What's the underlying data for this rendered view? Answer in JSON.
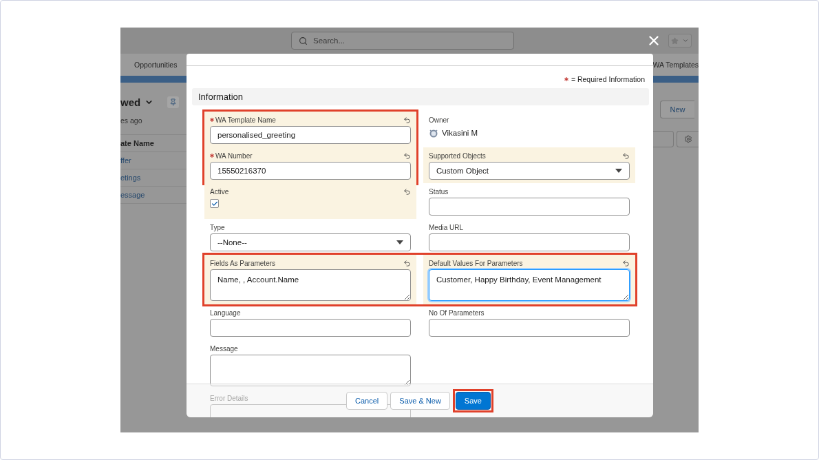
{
  "app": {
    "search": {
      "placeholder": "Search..."
    },
    "nav": [
      {
        "label": "Opportunities"
      },
      {
        "label": "WA Templates"
      }
    ],
    "list_view": {
      "title": "wed",
      "updated": "es ago",
      "column": "ate Name",
      "rows": [
        "ffer",
        "etings",
        "essage"
      ]
    },
    "new_button": "New"
  },
  "modal": {
    "required_note": "= Required Information",
    "section": "Information",
    "blocks": [
      {
        "kind": "columns",
        "columns": [
          [
            {
              "kind": "text",
              "label": "WA Template Name",
              "required": true,
              "changed": true,
              "annotated": true,
              "focused": false,
              "value": "personalised_greeting"
            },
            {
              "kind": "text",
              "label": "WA Number",
              "required": true,
              "changed": true,
              "annotated": true,
              "focused": false,
              "value": "15550216370"
            },
            {
              "kind": "checkbox",
              "label": "Active",
              "required": false,
              "changed": true,
              "annotated": false,
              "checked": true
            }
          ],
          [
            {
              "kind": "owner",
              "label": "Owner",
              "required": false,
              "changed": false,
              "annotated": false,
              "value": "Vikasini M"
            },
            {
              "kind": "select",
              "label": "Supported Objects",
              "required": false,
              "changed": true,
              "annotated": false,
              "value": "Custom Object"
            },
            {
              "kind": "text",
              "label": "Status",
              "required": false,
              "changed": false,
              "annotated": false,
              "focused": false
            }
          ]
        ]
      },
      {
        "kind": "row",
        "annotated": false,
        "cells": [
          {
            "kind": "select",
            "label": "Type",
            "required": false,
            "changed": false,
            "value": "--None--"
          },
          {
            "kind": "text",
            "label": "Media URL",
            "required": false,
            "changed": false,
            "focused": false
          }
        ]
      },
      {
        "kind": "row",
        "annotated": true,
        "cells": [
          {
            "kind": "textarea",
            "label": "Fields As Parameters",
            "required": false,
            "changed": true,
            "focused": false,
            "value": "Name, , Account.Name"
          },
          {
            "kind": "textarea",
            "label": "Default Values For Parameters",
            "required": false,
            "changed": true,
            "focused": true,
            "value": "Customer, Happy Birthday, Event Management"
          }
        ]
      },
      {
        "kind": "row",
        "annotated": false,
        "cells": [
          {
            "kind": "text",
            "label": "Language",
            "required": false,
            "changed": false,
            "focused": false
          },
          {
            "kind": "text",
            "label": "No Of Parameters",
            "required": false,
            "changed": false,
            "focused": false
          }
        ]
      },
      {
        "kind": "row",
        "annotated": false,
        "cells": [
          {
            "kind": "textarea",
            "label": "Message",
            "required": false,
            "changed": false,
            "focused": false
          }
        ]
      },
      {
        "kind": "row",
        "annotated": false,
        "cells": [
          {
            "kind": "text",
            "label": "Error Details",
            "required": false,
            "changed": false,
            "focused": false
          }
        ]
      }
    ],
    "buttons": [
      {
        "label": "Cancel",
        "kind": "neutral",
        "annotated": false
      },
      {
        "label": "Save & New",
        "kind": "neutral",
        "annotated": false
      },
      {
        "label": "Save",
        "kind": "brand",
        "annotated": true
      }
    ]
  }
}
